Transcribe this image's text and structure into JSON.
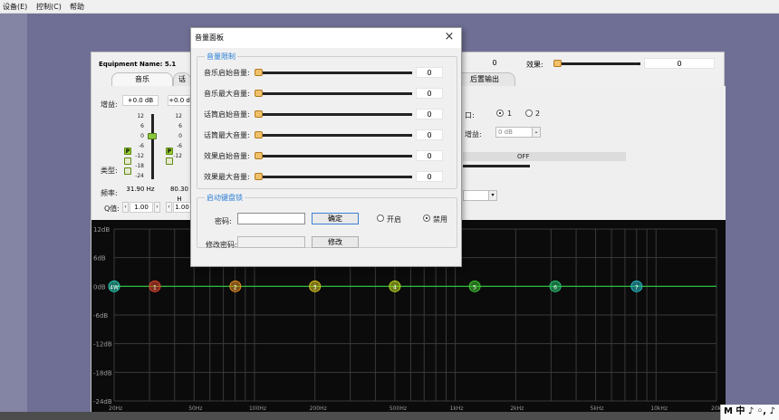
{
  "menubar": {
    "items": [
      "设备(E)",
      "控制(C)",
      "帮助"
    ]
  },
  "main": {
    "equipment_name": "Equipment Name: 5.1",
    "top_left_value": "0",
    "effect_label": "效果:",
    "effect_value": "0",
    "tabs": [
      {
        "label": "音乐",
        "active": true
      },
      {
        "label": "话",
        "active": false
      },
      {
        "label": "后置输出",
        "active": false
      }
    ],
    "gain_label": "增益:",
    "gain_values": [
      "+0.0 dB",
      "+0.0 d"
    ],
    "type_label": "类型:",
    "freq_label": "频率:",
    "freq_values": [
      "31.90 Hz",
      "80.30 H"
    ],
    "q_label": "Q值:",
    "q_values": [
      "1.00",
      "1.00"
    ],
    "tick_labels": [
      "12",
      "6",
      "0",
      "-6",
      "-12",
      "-18",
      "-24"
    ],
    "right_port_label": "口:",
    "radio1_label": "1",
    "radio2_label": "2",
    "right_gain_label": "增益:",
    "right_gain_value": "0 dB",
    "off_label": "OFF",
    "graph": {
      "y_labels": [
        "12dB",
        "6dB",
        "0dB",
        "-6dB",
        "-12dB",
        "-18dB",
        "-24dB"
      ],
      "x_labels": [
        "20Hz",
        "50Hz",
        "100Hz",
        "200Hz",
        "500Hz",
        "1kHz",
        "2kHz",
        "5kHz",
        "10kHz",
        "20kHz"
      ],
      "nodes": [
        {
          "label": "4W",
          "color": "#26c6b0",
          "freq": 20
        },
        {
          "label": "1",
          "color": "#e0452b",
          "freq": 31.9
        },
        {
          "label": "2",
          "color": "#e08a1d",
          "freq": 80.3
        },
        {
          "label": "3",
          "color": "#d8c21f",
          "freq": 200
        },
        {
          "label": "4",
          "color": "#b8d41f",
          "freq": 500
        },
        {
          "label": "5",
          "color": "#3fc02f",
          "freq": 1250
        },
        {
          "label": "6",
          "color": "#26c06e",
          "freq": 3150
        },
        {
          "label": "7",
          "color": "#26b6c0",
          "freq": 8000
        }
      ],
      "line_color": "#2ecc40"
    }
  },
  "dialog": {
    "title": "音量面板",
    "limit_group": "音量限制",
    "rows": [
      {
        "label": "音乐启始音量:",
        "value": "0"
      },
      {
        "label": "音乐最大音量:",
        "value": "0"
      },
      {
        "label": "话筒启始音量:",
        "value": "0"
      },
      {
        "label": "话筒最大音量:",
        "value": "0"
      },
      {
        "label": "效果启始音量:",
        "value": "0"
      },
      {
        "label": "效果最大音量:",
        "value": "0"
      }
    ],
    "lock_group": "启动键盘锁",
    "password_label": "密码:",
    "password_value": "",
    "confirm_label": "确定",
    "on_label": "开启",
    "off_label": "禁用",
    "change_pw_label": "修改密码:",
    "change_label": "修改"
  },
  "ime": {
    "text": "M 中 ♪ ◦, ♪"
  }
}
